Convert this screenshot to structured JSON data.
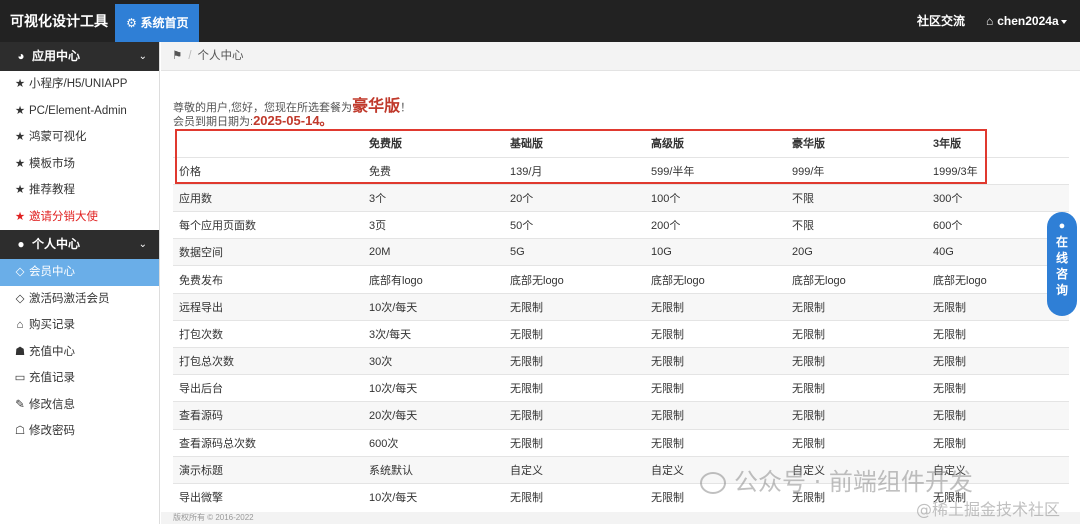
{
  "app": {
    "title": "可视化设计工具",
    "home_tab": "系统首页",
    "home_icon": "gear-icon",
    "nav_community": "社区交流",
    "nav_user": "chen2024a",
    "user_icon": "home-icon",
    "accent_color": "#2f7fd6"
  },
  "sidebar": {
    "section_apps": {
      "label": "应用中心",
      "icon": "dashboard-icon"
    },
    "apps": [
      {
        "label": "小程序/H5/UNIAPP",
        "icon": "star-icon"
      },
      {
        "label": "PC/Element-Admin",
        "icon": "star-icon"
      },
      {
        "label": "鸿蒙可视化",
        "icon": "star-icon"
      },
      {
        "label": "模板市场",
        "icon": "star-icon"
      },
      {
        "label": "推荐教程",
        "icon": "star-icon"
      },
      {
        "label": "邀请分销大使",
        "icon": "star-icon"
      }
    ],
    "section_personal": {
      "label": "个人中心",
      "icon": "users-icon"
    },
    "personal": [
      {
        "label": "会员中心",
        "icon": "diamond-icon"
      },
      {
        "label": "激活码激活会员",
        "icon": "diamond-icon"
      },
      {
        "label": "购买记录",
        "icon": "cart-icon"
      },
      {
        "label": "充值中心",
        "icon": "bank-icon"
      },
      {
        "label": "充值记录",
        "icon": "card-icon"
      },
      {
        "label": "修改信息",
        "icon": "edit-icon"
      },
      {
        "label": "修改密码",
        "icon": "lock-icon"
      }
    ]
  },
  "breadcrumb": {
    "icon": "map-marker-icon",
    "separator": "/",
    "current": "个人中心"
  },
  "membership": {
    "greeting_prefix": "尊敬的用户,您好，您现在所选套餐为",
    "level": "豪华版",
    "greeting_suffix": "！",
    "expire_prefix": "会员到期日期为:",
    "expire_date": "2025-05-14。"
  },
  "plans": {
    "headers": [
      "",
      "免费版",
      "基础版",
      "高级版",
      "豪华版",
      "3年版"
    ],
    "rows": [
      [
        "价格",
        "免费",
        "139/月",
        "599/半年",
        "999/年",
        "1999/3年"
      ],
      [
        "应用数",
        "3个",
        "20个",
        "100个",
        "不限",
        "300个"
      ],
      [
        "每个应用页面数",
        "3页",
        "50个",
        "200个",
        "不限",
        "600个"
      ],
      [
        "数据空间",
        "20M",
        "5G",
        "10G",
        "20G",
        "40G"
      ],
      [
        "免费发布",
        "底部有logo",
        "底部无logo",
        "底部无logo",
        "底部无logo",
        "底部无logo"
      ],
      [
        "远程导出",
        "10次/每天",
        "无限制",
        "无限制",
        "无限制",
        "无限制"
      ],
      [
        "打包次数",
        "3次/每天",
        "无限制",
        "无限制",
        "无限制",
        "无限制"
      ],
      [
        "打包总次数",
        "30次",
        "无限制",
        "无限制",
        "无限制",
        "无限制"
      ],
      [
        "导出后台",
        "10次/每天",
        "无限制",
        "无限制",
        "无限制",
        "无限制"
      ],
      [
        "查看源码",
        "20次/每天",
        "无限制",
        "无限制",
        "无限制",
        "无限制"
      ],
      [
        "查看源码总次数",
        "600次",
        "无限制",
        "无限制",
        "无限制",
        "无限制"
      ],
      [
        "演示标题",
        "系统默认",
        "自定义",
        "自定义",
        "自定义",
        "自定义"
      ],
      [
        "导出微擎",
        "10次/每天",
        "无限制",
        "无限制",
        "无限制",
        "无限制"
      ]
    ]
  },
  "footer": {
    "copyright": "版权所有 © 2016-2022"
  },
  "consult": {
    "icon": "bell-icon",
    "label": [
      "在",
      "线",
      "咨",
      "询"
    ]
  },
  "watermark": {
    "line1": "公众号 · 前端组件开发",
    "line2": "@稀土掘金技术社区"
  }
}
